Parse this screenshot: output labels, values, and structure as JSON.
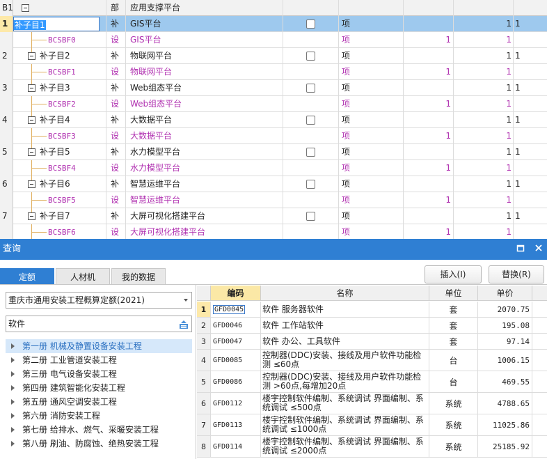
{
  "grid": {
    "header": {
      "index": "B1",
      "type": "部",
      "name": "应用支撑平台"
    },
    "rows": [
      {
        "index": "1",
        "code": "补子目1",
        "type": "补",
        "name": "GIS平台",
        "unit": "项",
        "qty": "",
        "qty2": "1",
        "last": "1",
        "sub": false,
        "selected": true
      },
      {
        "index": "",
        "code": "BCSBF0",
        "type": "设",
        "name": "GIS平台",
        "unit": "项",
        "qty": "1",
        "qty2": "1",
        "last": "",
        "sub": true
      },
      {
        "index": "2",
        "code": "补子目2",
        "type": "补",
        "name": "物联网平台",
        "unit": "项",
        "qty": "",
        "qty2": "1",
        "last": "1",
        "sub": false
      },
      {
        "index": "",
        "code": "BCSBF1",
        "type": "设",
        "name": "物联网平台",
        "unit": "项",
        "qty": "1",
        "qty2": "1",
        "last": "",
        "sub": true
      },
      {
        "index": "3",
        "code": "补子目3",
        "type": "补",
        "name": "Web组态平台",
        "unit": "项",
        "qty": "",
        "qty2": "1",
        "last": "1",
        "sub": false
      },
      {
        "index": "",
        "code": "BCSBF2",
        "type": "设",
        "name": "Web组态平台",
        "unit": "项",
        "qty": "1",
        "qty2": "1",
        "last": "",
        "sub": true
      },
      {
        "index": "4",
        "code": "补子目4",
        "type": "补",
        "name": "大数据平台",
        "unit": "项",
        "qty": "",
        "qty2": "1",
        "last": "1",
        "sub": false
      },
      {
        "index": "",
        "code": "BCSBF3",
        "type": "设",
        "name": "大数据平台",
        "unit": "项",
        "qty": "1",
        "qty2": "1",
        "last": "",
        "sub": true
      },
      {
        "index": "5",
        "code": "补子目5",
        "type": "补",
        "name": "水力模型平台",
        "unit": "项",
        "qty": "",
        "qty2": "1",
        "last": "1",
        "sub": false
      },
      {
        "index": "",
        "code": "BCSBF4",
        "type": "设",
        "name": "水力模型平台",
        "unit": "项",
        "qty": "1",
        "qty2": "1",
        "last": "",
        "sub": true
      },
      {
        "index": "6",
        "code": "补子目6",
        "type": "补",
        "name": "智慧运维平台",
        "unit": "项",
        "qty": "",
        "qty2": "1",
        "last": "1",
        "sub": false
      },
      {
        "index": "",
        "code": "BCSBF5",
        "type": "设",
        "name": "智慧运维平台",
        "unit": "项",
        "qty": "1",
        "qty2": "1",
        "last": "",
        "sub": true
      },
      {
        "index": "7",
        "code": "补子目7",
        "type": "补",
        "name": "大屏可视化搭建平台",
        "unit": "项",
        "qty": "",
        "qty2": "1",
        "last": "1",
        "sub": false
      },
      {
        "index": "",
        "code": "BCSBF6",
        "type": "设",
        "name": "大屏可视化搭建平台",
        "unit": "项",
        "qty": "1",
        "qty2": "1",
        "last": "",
        "sub": true
      }
    ]
  },
  "query": {
    "title": "查询",
    "tabs": [
      "定额",
      "人材机",
      "我的数据"
    ],
    "insert_label": "插入(I)",
    "replace_label": "替换(R)",
    "quota_library": "重庆市通用安装工程概算定额(2021)",
    "search_value": "软件",
    "volumes": [
      "第一册 机械及静置设备安装工程",
      "第二册 工业管道安装工程",
      "第三册 电气设备安装工程",
      "第四册 建筑智能化安装工程",
      "第五册 通风空调安装工程",
      "第六册 消防安装工程",
      "第七册 给排水、燃气、采暖安装工程",
      "第八册 刷油、防腐蚀、绝热安装工程"
    ],
    "table_headers": {
      "code": "编码",
      "name": "名称",
      "unit": "单位",
      "price": "单价"
    },
    "results": [
      {
        "index": "1",
        "code": "GFD0045",
        "name": "软件 服务器软件",
        "unit": "套",
        "price": "2070.75"
      },
      {
        "index": "2",
        "code": "GFD0046",
        "name": "软件 工作站软件",
        "unit": "套",
        "price": "195.08"
      },
      {
        "index": "3",
        "code": "GFD0047",
        "name": "软件 办公、工具软件",
        "unit": "套",
        "price": "97.14"
      },
      {
        "index": "4",
        "code": "GFD0085",
        "name": "控制器(DDC)安装、接线及用户软件功能检测 ≤60点",
        "unit": "台",
        "price": "1006.15"
      },
      {
        "index": "5",
        "code": "GFD0086",
        "name": "控制器(DDC)安装、接线及用户软件功能检测 >60点,每增加20点",
        "unit": "台",
        "price": "469.55"
      },
      {
        "index": "6",
        "code": "GFD0112",
        "name": "楼宇控制软件编制、系统调试 界面编制、系统调试 ≤500点",
        "unit": "系统",
        "price": "4788.65"
      },
      {
        "index": "7",
        "code": "GFD0113",
        "name": "楼宇控制软件编制、系统调试 界面编制、系统调试 ≤1000点",
        "unit": "系统",
        "price": "11025.86"
      },
      {
        "index": "8",
        "code": "GFD0114",
        "name": "楼宇控制软件编制、系统调试 界面编制、系统调试 ≤2000点",
        "unit": "系统",
        "price": "25185.92"
      }
    ]
  },
  "colors": {
    "accent": "#2f7fd3",
    "selected_row": "#9ec9ee",
    "sub_item_text": "#b030b0",
    "tree_line": "#e0b060"
  }
}
